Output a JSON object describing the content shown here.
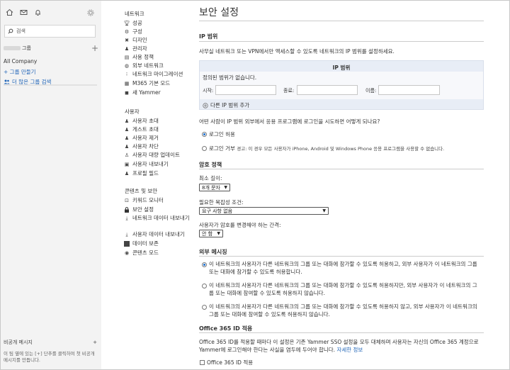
{
  "left": {
    "search_placeholder": "검색",
    "group_label": "그룹",
    "all_company": "All Company",
    "new_group": "+ 그룹 만들기",
    "more_groups": "더 많은 그룹 검색",
    "dm_title": "비공개 메시지",
    "dm_desc": "이 팀 옆에 있는 [+] 단추를 클릭하여 첫 비공개 메시지를 만듭니다."
  },
  "nav": {
    "network_header": "네트워크",
    "network_items": [
      {
        "label": "성공",
        "icon": "trophy-icon"
      },
      {
        "label": "구성",
        "icon": "gear-icon"
      },
      {
        "label": "디자인",
        "icon": "tools-icon"
      },
      {
        "label": "관리자",
        "icon": "admin-icon"
      },
      {
        "label": "사용 정책",
        "icon": "document-icon"
      },
      {
        "label": "외부 네트워크",
        "icon": "globe-icon"
      },
      {
        "label": "네트워크 마이그레이션",
        "icon": "migrate-icon"
      },
      {
        "label": "M365 기본 모드",
        "icon": "m365-icon"
      },
      {
        "label": "새 Yammer",
        "icon": "yammer-icon"
      }
    ],
    "users_header": "사용자",
    "users_items": [
      {
        "label": "사용자 초대",
        "icon": "invite-user-icon"
      },
      {
        "label": "게스트 초대",
        "icon": "invite-guest-icon"
      },
      {
        "label": "사용자 제거",
        "icon": "remove-user-icon"
      },
      {
        "label": "사용자 차단",
        "icon": "block-user-icon"
      },
      {
        "label": "사용자 대량 업데이트",
        "icon": "bulk-update-icon"
      },
      {
        "label": "사용자 내보내기",
        "icon": "export-icon"
      },
      {
        "label": "프로필 필드",
        "icon": "profile-icon"
      }
    ],
    "content_header": "콘텐츠 및 보안",
    "content_items": [
      {
        "label": "키워드 모니터",
        "icon": "monitor-icon"
      },
      {
        "label": "보안 설정",
        "icon": "lock-icon"
      },
      {
        "label": "네트워크 데이터 내보내기",
        "icon": "download-icon"
      },
      {
        "label": "사용자 데이터 내보내기",
        "icon": "download-icon"
      },
      {
        "label": "데이터 보존",
        "icon": "retention-icon"
      },
      {
        "label": "콘텐츠 모드",
        "icon": "eye-icon"
      }
    ]
  },
  "main": {
    "title": "보안 설정",
    "ip": {
      "heading": "IP 범위",
      "desc": "사무실 네트워크 또는 VPN에서만 액세스할 수 있도록 네트워크의 IP 범위를 설정하세요.",
      "table_header": "IP 범위",
      "empty": "정의된 범위가 없습니다.",
      "start_label": "시작:",
      "end_label": "종료:",
      "name_label": "이름:",
      "add_label": "다른 IP 범위 추가",
      "question": "어떤 사람이 IP 범위 외부에서 응용 프로그램에 로그인을 시도하면 어떻게 되나요?",
      "allow": "로그인 허용",
      "deny": "로그인 거부",
      "deny_warning": "경고: 이 경우 모든 사용자가 iPhone, Android 및 Windows Phone 응용 프로그램을 사용할 수 없습니다."
    },
    "password": {
      "heading": "암호 정책",
      "min_length_label": "최소 길이:",
      "min_length_value": "8개 문자",
      "complexity_label": "필요한 복잡성 조건:",
      "complexity_value": "요구 사항 없음",
      "interval_label": "사용자가 암호를 변경해야 하는 간격:",
      "interval_value": "안 함"
    },
    "external": {
      "heading": "외부 메시징",
      "opt1_line1": "이 네트워크의 사용자가 다른 네트워크의 그룹 또는 대화에 참가할 수 있도록 허용하고, 외부 사용자가 이 네트워크의 그룹",
      "opt1_line2": "또는 대화에 참가할 수 있도록 허용합니다.",
      "opt2_line1": "이 네트워크의 사용자가 다른 네트워크의 그룹 또는 대화에 참가할 수 있도록 허용하지만, 외부 사용자가 이 네트워크의 그",
      "opt2_line2": "룹 또는 대화에 참여할 수 있도록 허용하지 않습니다.",
      "opt3_line1": "이 네트워크의 사용자가 다른 네트워크의 그룹 또는 대화에 참가할 수 있도록 허용하지 않고, 외부 사용자가 이 네트워크의",
      "opt3_line2": "그룹 또는 대화에 참여할 수 있도록 허용하지 않습니다."
    },
    "o365": {
      "heading": "Office 365 ID 적용",
      "line1": "Office 365 ID를 적용할 때마다 이 설정은 기존 Yammer SSO 설정을 모두 대체하며 사용자는 자신의 Office 365 계정으로",
      "line2": "Yammer에 로그인해야 한다는 사실을 염두에 두어야 합니다.",
      "more_link": "자세한 정보",
      "checkbox_label": "Office 365 ID 적용"
    }
  }
}
